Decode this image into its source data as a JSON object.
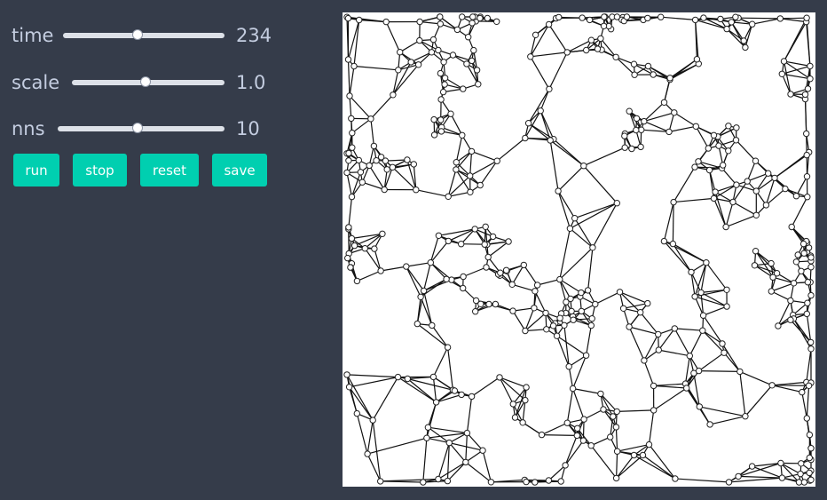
{
  "controls": {
    "time": {
      "label": "time",
      "value": "234",
      "fraction": 0.46
    },
    "scale": {
      "label": "scale",
      "value": "1.0",
      "fraction": 0.48
    },
    "nns": {
      "label": "nns",
      "value": "10",
      "fraction": 0.48
    }
  },
  "buttons": {
    "run": "run",
    "stop": "stop",
    "reset": "reset",
    "save": "save"
  },
  "colors": {
    "background": "#353c4a",
    "text": "#c4cde0",
    "button": "#00cfb0",
    "canvas": "#ffffff",
    "edge": "#111111",
    "node_fill": "#ffffff",
    "node_stroke": "#222222"
  }
}
